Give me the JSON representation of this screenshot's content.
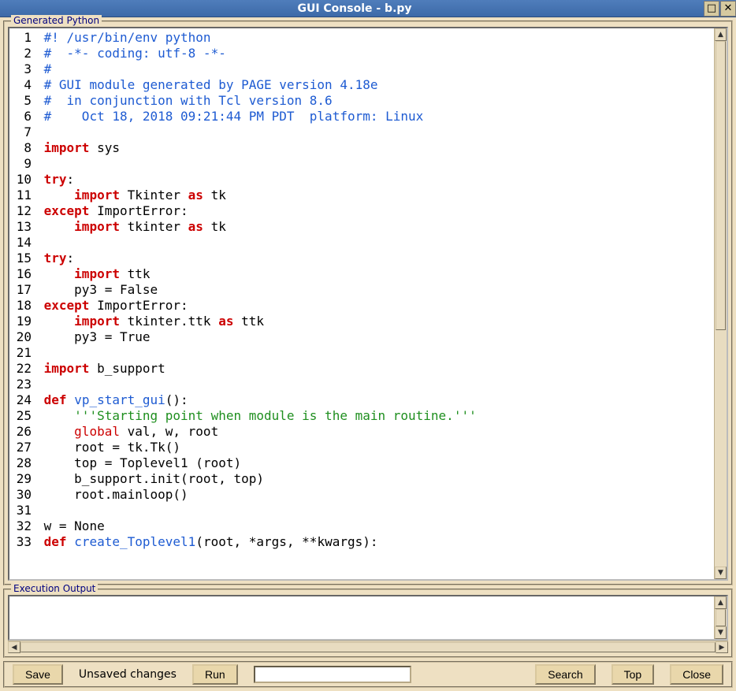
{
  "window": {
    "title": "GUI Console - b.py",
    "maximize_glyph": "□",
    "close_glyph": "✕"
  },
  "frames": {
    "generated_label": "Generated Python",
    "output_label": "Execution Output"
  },
  "scroll": {
    "v_thumb_top_pct": 0,
    "v_thumb_height_pct": 55,
    "out_v_thumb_top_pct": 0,
    "out_v_thumb_height_pct": 100,
    "out_h_thumb_width_pct": 100
  },
  "code_lines": [
    {
      "n": 1,
      "tokens": [
        {
          "cls": "c",
          "t": "#! /usr/bin/env python"
        }
      ]
    },
    {
      "n": 2,
      "tokens": [
        {
          "cls": "c",
          "t": "#  -*- coding: utf-8 -*-"
        }
      ]
    },
    {
      "n": 3,
      "tokens": [
        {
          "cls": "c",
          "t": "#"
        }
      ]
    },
    {
      "n": 4,
      "tokens": [
        {
          "cls": "c",
          "t": "# GUI module generated by PAGE version 4.18e"
        }
      ]
    },
    {
      "n": 5,
      "tokens": [
        {
          "cls": "c",
          "t": "#  in conjunction with Tcl version 8.6"
        }
      ]
    },
    {
      "n": 6,
      "tokens": [
        {
          "cls": "c",
          "t": "#    Oct 18, 2018 09:21:44 PM PDT  platform: Linux"
        }
      ]
    },
    {
      "n": 7,
      "tokens": []
    },
    {
      "n": 8,
      "tokens": [
        {
          "cls": "kw",
          "t": "import"
        },
        {
          "t": " sys"
        }
      ]
    },
    {
      "n": 9,
      "tokens": []
    },
    {
      "n": 10,
      "tokens": [
        {
          "cls": "kw",
          "t": "try"
        },
        {
          "t": ":"
        }
      ]
    },
    {
      "n": 11,
      "tokens": [
        {
          "t": "    "
        },
        {
          "cls": "kw",
          "t": "import"
        },
        {
          "t": " Tkinter "
        },
        {
          "cls": "kw",
          "t": "as"
        },
        {
          "t": " tk"
        }
      ]
    },
    {
      "n": 12,
      "tokens": [
        {
          "cls": "kw",
          "t": "except"
        },
        {
          "t": " ImportError:"
        }
      ]
    },
    {
      "n": 13,
      "tokens": [
        {
          "t": "    "
        },
        {
          "cls": "kw",
          "t": "import"
        },
        {
          "t": " tkinter "
        },
        {
          "cls": "kw",
          "t": "as"
        },
        {
          "t": " tk"
        }
      ]
    },
    {
      "n": 14,
      "tokens": []
    },
    {
      "n": 15,
      "tokens": [
        {
          "cls": "kw",
          "t": "try"
        },
        {
          "t": ":"
        }
      ]
    },
    {
      "n": 16,
      "tokens": [
        {
          "t": "    "
        },
        {
          "cls": "kw",
          "t": "import"
        },
        {
          "t": " ttk"
        }
      ]
    },
    {
      "n": 17,
      "tokens": [
        {
          "t": "    py3 = False"
        }
      ]
    },
    {
      "n": 18,
      "tokens": [
        {
          "cls": "kw",
          "t": "except"
        },
        {
          "t": " ImportError:"
        }
      ]
    },
    {
      "n": 19,
      "tokens": [
        {
          "t": "    "
        },
        {
          "cls": "kw",
          "t": "import"
        },
        {
          "t": " tkinter.ttk "
        },
        {
          "cls": "kw",
          "t": "as"
        },
        {
          "t": " ttk"
        }
      ]
    },
    {
      "n": 20,
      "tokens": [
        {
          "t": "    py3 = True"
        }
      ]
    },
    {
      "n": 21,
      "tokens": []
    },
    {
      "n": 22,
      "tokens": [
        {
          "cls": "kw",
          "t": "import"
        },
        {
          "t": " b_support"
        }
      ]
    },
    {
      "n": 23,
      "tokens": []
    },
    {
      "n": 24,
      "tokens": [
        {
          "cls": "kw",
          "t": "def"
        },
        {
          "t": " "
        },
        {
          "cls": "fn",
          "t": "vp_start_gui"
        },
        {
          "t": "():"
        }
      ]
    },
    {
      "n": 25,
      "tokens": [
        {
          "t": "    "
        },
        {
          "cls": "st",
          "t": "'''Starting point when module is the main routine.'''"
        }
      ]
    },
    {
      "n": 26,
      "tokens": [
        {
          "t": "    "
        },
        {
          "cls": "kw2",
          "t": "global"
        },
        {
          "t": " val, w, root"
        }
      ]
    },
    {
      "n": 27,
      "tokens": [
        {
          "t": "    root = tk.Tk()"
        }
      ]
    },
    {
      "n": 28,
      "tokens": [
        {
          "t": "    top = Toplevel1 (root)"
        }
      ]
    },
    {
      "n": 29,
      "tokens": [
        {
          "t": "    b_support.init(root, top)"
        }
      ]
    },
    {
      "n": 30,
      "tokens": [
        {
          "t": "    root.mainloop()"
        }
      ]
    },
    {
      "n": 31,
      "tokens": []
    },
    {
      "n": 32,
      "tokens": [
        {
          "t": "w = None"
        }
      ]
    },
    {
      "n": 33,
      "tokens": [
        {
          "cls": "kw",
          "t": "def"
        },
        {
          "t": " "
        },
        {
          "cls": "fn",
          "t": "create_Toplevel1"
        },
        {
          "t": "(root, *args, **kwargs):"
        }
      ]
    }
  ],
  "buttons": {
    "save": "Save",
    "status": "Unsaved changes",
    "run": "Run",
    "search": "Search",
    "top": "Top",
    "close": "Close"
  },
  "search_input": {
    "value": "",
    "placeholder": ""
  }
}
